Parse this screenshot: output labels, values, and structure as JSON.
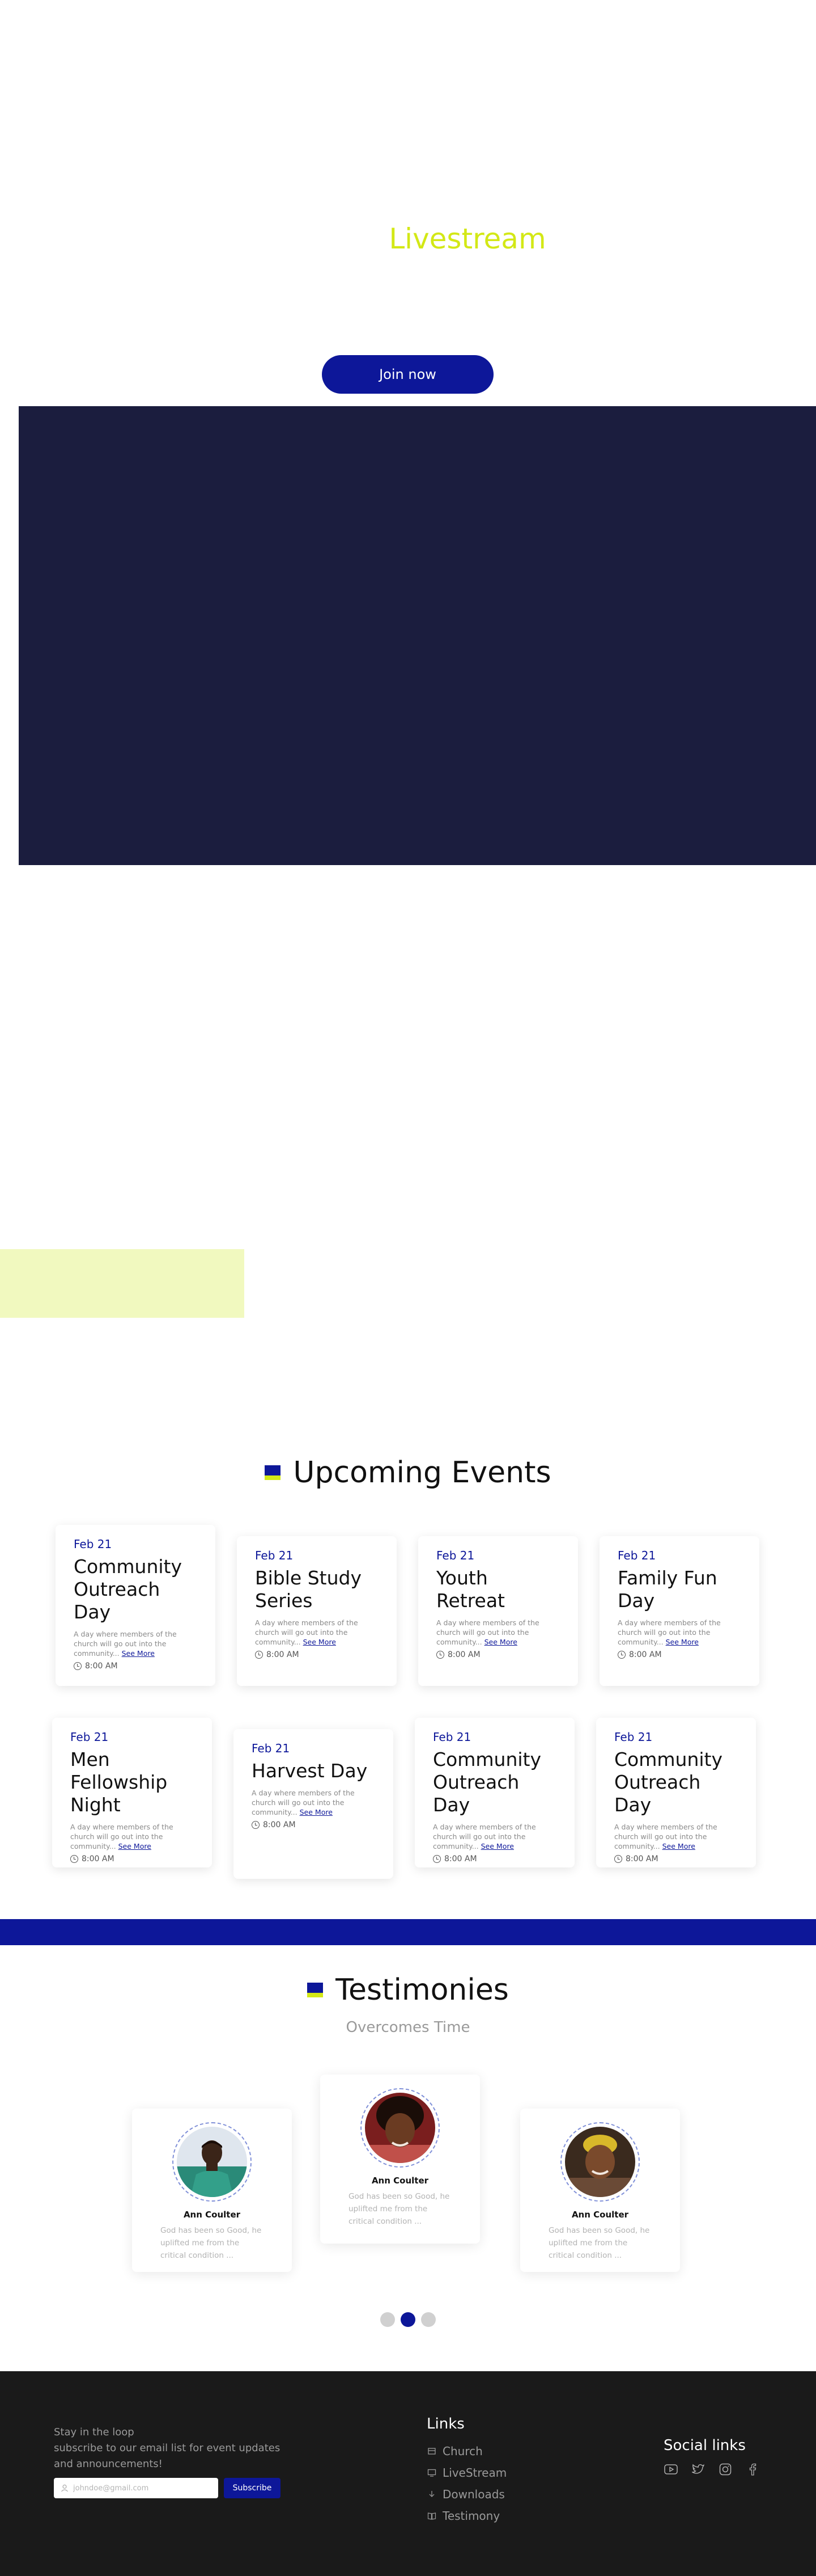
{
  "hero": {
    "title": "Livestream",
    "join_label": "Join now"
  },
  "events": {
    "title": "Upcoming Events",
    "see_more": "See More",
    "items": [
      {
        "date": "Feb 21",
        "title": "Community Outreach Day",
        "desc": "A day where members of the church will go out into the community...",
        "time": "8:00 AM"
      },
      {
        "date": "Feb 21",
        "title": "Bible Study Series",
        "desc": "A day where members of the church will go out into the community...",
        "time": "8:00 AM"
      },
      {
        "date": "Feb 21",
        "title": "Youth Retreat",
        "desc": "A day where members of the church will go out into the community...",
        "time": "8:00 AM"
      },
      {
        "date": "Feb 21",
        "title": "Family Fun Day",
        "desc": "A day where members of the church will go out into the community...",
        "time": "8:00 AM"
      },
      {
        "date": "Feb 21",
        "title": "Men Fellowship Night",
        "desc": "A day where members of the church will go out into the community...",
        "time": "8:00 AM"
      },
      {
        "date": "Feb 21",
        "title": "Harvest Day",
        "desc": "A day where members of the church will go out into the community...",
        "time": "8:00 AM"
      },
      {
        "date": "Feb 21",
        "title": "Community Outreach Day",
        "desc": "A day where members of the church will go out into the community...",
        "time": "8:00 AM"
      },
      {
        "date": "Feb 21",
        "title": "Community Outreach Day",
        "desc": "A day where members of the church will go out into the community...",
        "time": "8:00 AM"
      }
    ]
  },
  "testimonies": {
    "title": "Testimonies",
    "subtitle": "Overcomes Time",
    "items": [
      {
        "name": "Ann Coulter",
        "text": "God has been so Good, he uplifted me from the critical condition ..."
      },
      {
        "name": "Ann Coulter",
        "text": "God has been so Good, he uplifted me from the critical condition ..."
      },
      {
        "name": "Ann Coulter",
        "text": "God has been so Good, he uplifted me from the critical condition ..."
      }
    ]
  },
  "footer": {
    "newsletter_line1": "Stay in the loop",
    "newsletter_line2": "subscribe to our email list for event updates and announcements!",
    "email_placeholder": "johndoe@gmail.com",
    "subscribe_label": "Subscribe",
    "links_title": "Links",
    "links": [
      {
        "label": "Church",
        "icon": "church-icon"
      },
      {
        "label": "LiveStream",
        "icon": "monitor-icon"
      },
      {
        "label": "Downloads",
        "icon": "download-icon"
      },
      {
        "label": "Testimony",
        "icon": "book-icon"
      }
    ],
    "social_title": "Social links",
    "social": [
      "youtube-icon",
      "twitter-icon",
      "instagram-icon",
      "facebook-icon"
    ]
  },
  "colors": {
    "primary": "#0d1799",
    "accent": "#d3e816",
    "dark_panel": "#1b1d3e",
    "footer_bg": "#1a1a1a"
  }
}
